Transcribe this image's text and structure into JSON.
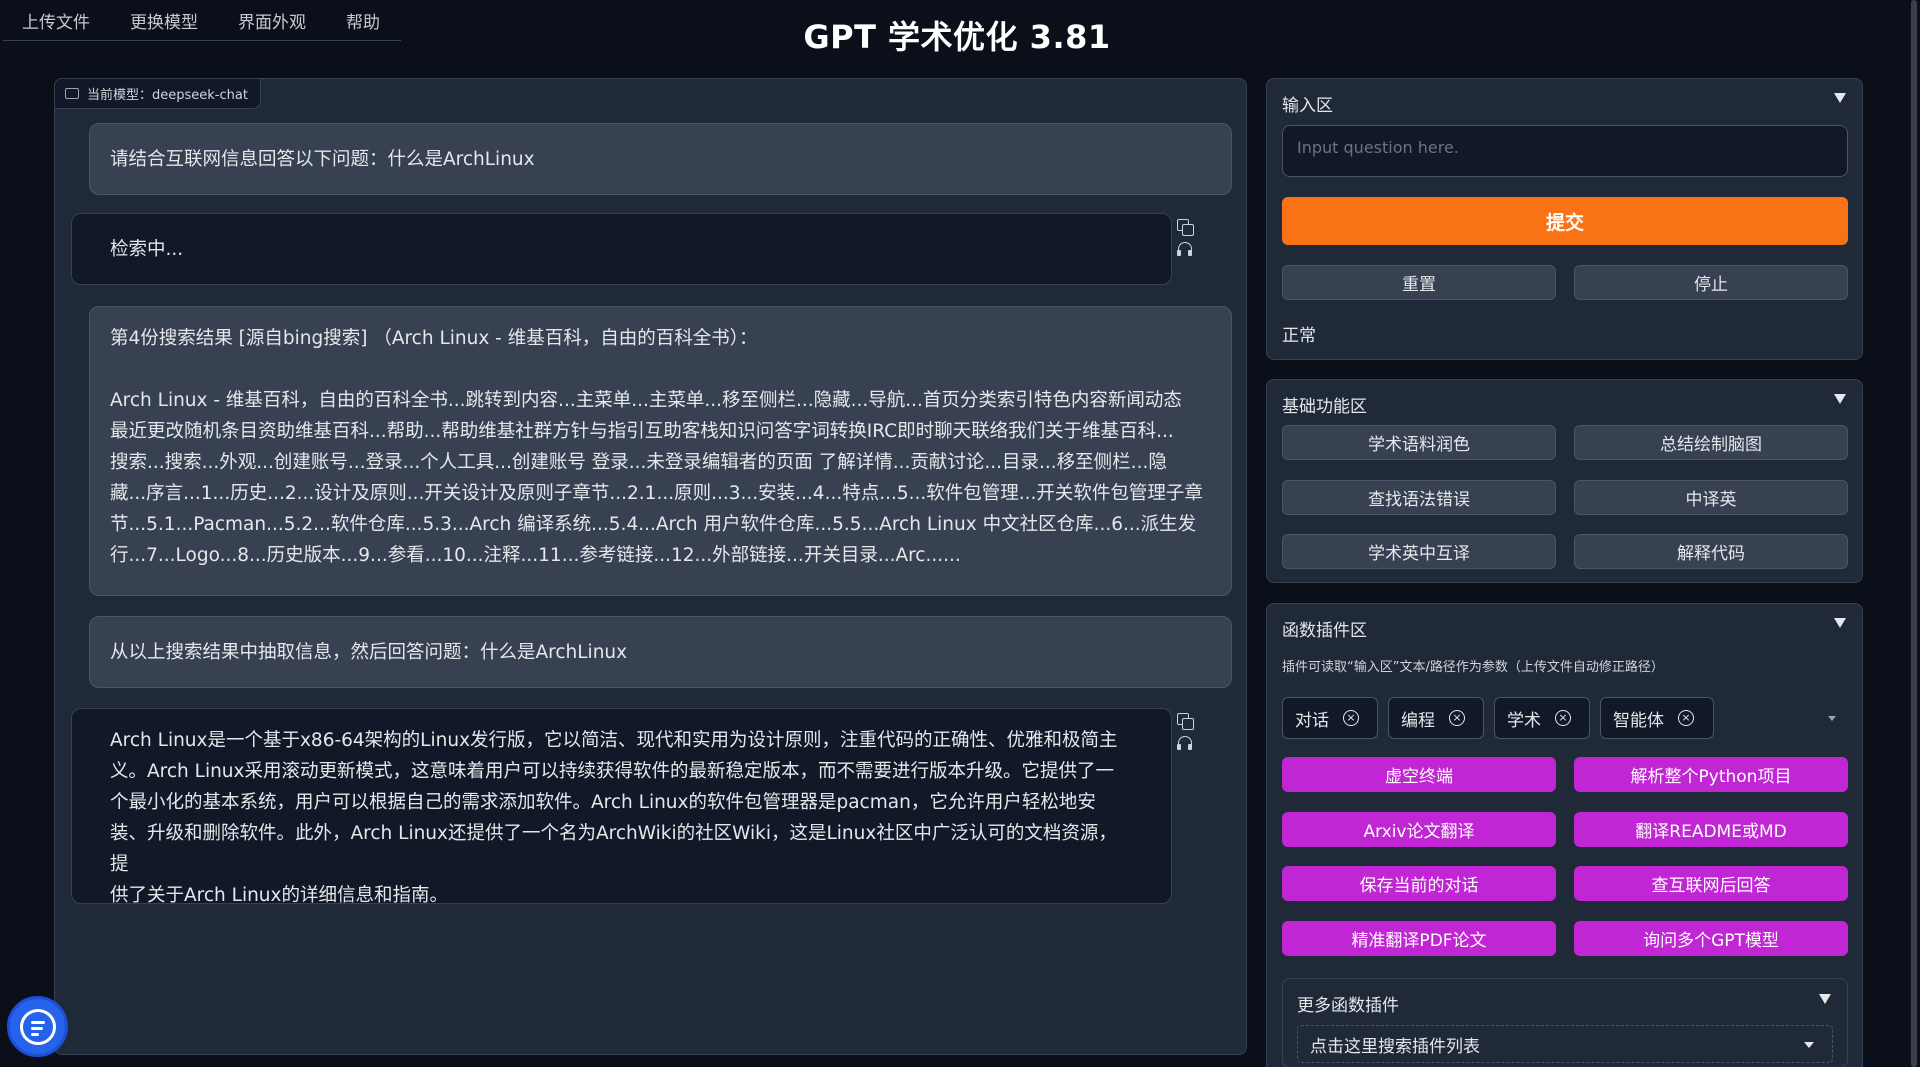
{
  "app": {
    "title": "GPT 学术优化 3.81"
  },
  "menu": [
    "上传文件",
    "更换模型",
    "界面外观",
    "帮助"
  ],
  "chat": {
    "model_label": "当前模型：deepseek-chat",
    "messages": [
      {
        "role": "user",
        "text": "请结合互联网信息回答以下问题：什么是ArchLinux"
      },
      {
        "role": "bot",
        "text": "检索中..."
      },
      {
        "role": "user",
        "text": "第4份搜索结果 [源自bing搜索] （Arch Linux - 维基百科，自由的百科全书）：\n\nArch Linux - 维基百科，自由的百科全书...跳转到内容...主菜单...主菜单...移至侧栏...隐藏...导航...首页分类索引特色内容新闻动态\n最近更改随机条目资助维基百科...帮助...帮助维基社群方针与指引互助客栈知识问答字词转换IRC即时聊天联络我们关于维基百科...\n搜索...搜索...外观...创建账号...登录...个人工具...创建账号 登录...未登录编辑者的页面 了解详情...贡献讨论...目录...移至侧栏...隐\n藏...序言...1...历史...2...设计及原则...开关设计及原则子章节...2.1...原则...3...安装...4...特点...5...软件包管理...开关软件包管理子章\n节...5.1...Pacman...5.2...软件仓库...5.3...Arch 编译系统...5.4...Arch 用户软件仓库...5.5...Arch Linux 中文社区仓库...6...派生发\n行...7...Logo...8...历史版本...9...参看...10...注释...11...参考链接...12...外部链接...开关目录...Arc......"
      },
      {
        "role": "user",
        "text": "从以上搜索结果中抽取信息，然后回答问题：什么是ArchLinux"
      },
      {
        "role": "bot",
        "text": "Arch Linux是一个基于x86-64架构的Linux发行版，它以简洁、现代和实用为设计原则，注重代码的正确性、优雅和极简主\n义。Arch Linux采用滚动更新模式，这意味着用户可以持续获得软件的最新稳定版本，而不需要进行版本升级。它提供了一\n个最小化的基本系统，用户可以根据自己的需求添加软件。Arch Linux的软件包管理器是pacman，它允许用户轻松地安\n装、升级和删除软件。此外，Arch Linux还提供了一个名为ArchWiki的社区Wiki，这是Linux社区中广泛认可的文档资源，提\n供了关于Arch Linux的详细信息和指南。"
      }
    ]
  },
  "input_panel": {
    "header": "输入区",
    "placeholder": "Input question here.",
    "submit": "提交",
    "reset": "重置",
    "stop": "停止",
    "status": "正常"
  },
  "basic_panel": {
    "header": "基础功能区",
    "buttons": [
      "学术语料润色",
      "总结绘制脑图",
      "查找语法错误",
      "中译英",
      "学术英中互译",
      "解释代码"
    ]
  },
  "plugin_panel": {
    "header": "函数插件区",
    "hint": "插件可读取“输入区”文本/路径作为参数（上传文件自动修正路径）",
    "chips": [
      "对话",
      "编程",
      "学术",
      "智能体"
    ],
    "chip_remove": "×",
    "buttons": [
      "虚空终端",
      "解析整个Python项目",
      "Arxiv论文翻译",
      "翻译README或MD",
      "保存当前的对话",
      "查互联网后回答",
      "精准翻译PDF论文",
      "询问多个GPT模型"
    ],
    "more": {
      "header": "更多函数插件",
      "dropdown": "点击这里搜索插件列表"
    }
  },
  "colors": {
    "submit": "#f97316",
    "plugin": "#c026d3",
    "fab": "#2563eb"
  }
}
